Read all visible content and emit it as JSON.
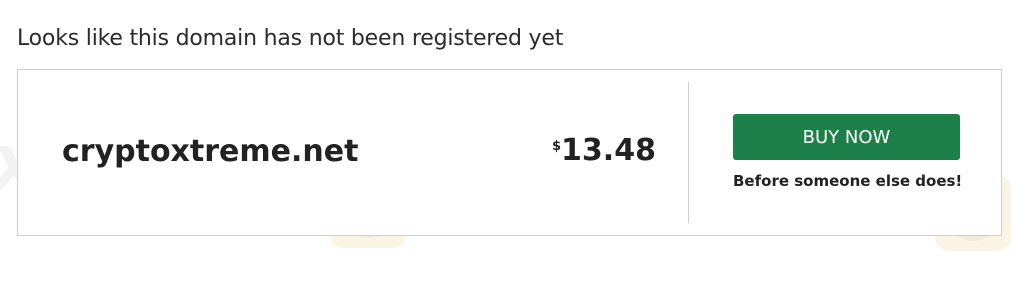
{
  "header": {
    "text": "Looks like this domain has not been registered yet"
  },
  "listing": {
    "domain": "cryptoxtreme.net",
    "currency_symbol": "$",
    "price": "13.48",
    "buy_label": "BUY NOW",
    "tagline": "Before someone else does!"
  },
  "watermark": {
    "text": "WikiFX",
    "icon": "wikifx-logo-icon"
  },
  "colors": {
    "button": "#1e8049",
    "border": "#cfcfcf",
    "watermark": "#f2e6c8"
  }
}
